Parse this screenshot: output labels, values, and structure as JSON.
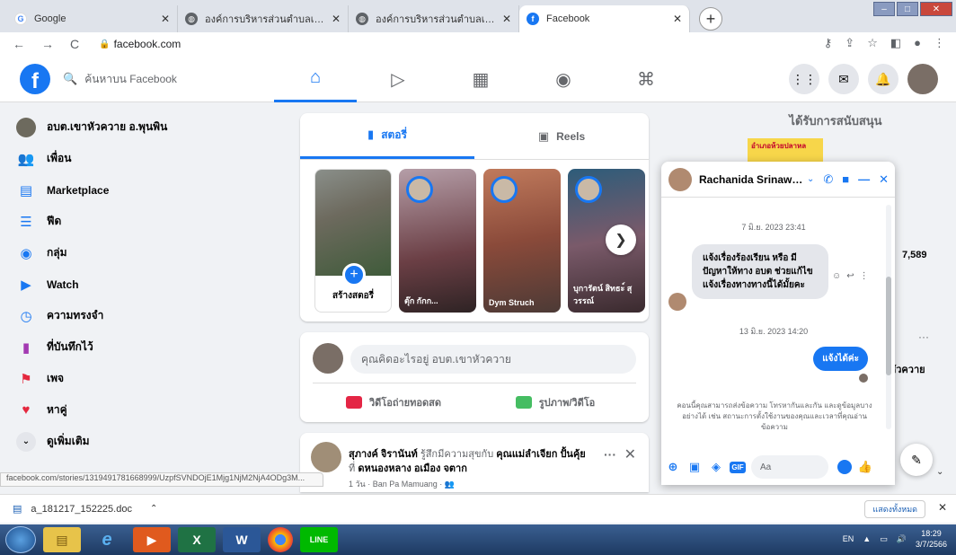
{
  "browser": {
    "tabs": [
      {
        "title": "Google",
        "icon": "google-icon"
      },
      {
        "title": "องค์การบริหารส่วนตำบลเขาหัวควาย",
        "icon": "globe-icon"
      },
      {
        "title": "องค์การบริหารส่วนตำบลเขาหัวควาย",
        "icon": "globe-icon"
      },
      {
        "title": "Facebook",
        "icon": "facebook-icon"
      }
    ],
    "url": "facebook.com"
  },
  "facebook": {
    "logo": "f",
    "search_placeholder": "ค้นหาบน Facebook"
  },
  "sidebar": {
    "items": [
      {
        "label": "อบต.เขาหัวควาย อ.พุนพิน",
        "icon": "page-avatar-icon"
      },
      {
        "label": "เพื่อน",
        "icon": "friends-icon"
      },
      {
        "label": "Marketplace",
        "icon": "marketplace-icon"
      },
      {
        "label": "ฟีด",
        "icon": "feeds-icon"
      },
      {
        "label": "กลุ่ม",
        "icon": "groups-icon"
      },
      {
        "label": "Watch",
        "icon": "watch-icon"
      },
      {
        "label": "ความทรงจำ",
        "icon": "memories-icon"
      },
      {
        "label": "ที่บันทึกไว้",
        "icon": "saved-icon"
      },
      {
        "label": "เพจ",
        "icon": "pages-icon"
      },
      {
        "label": "หาคู่",
        "icon": "dating-icon"
      },
      {
        "label": "ดูเพิ่มเติม",
        "icon": "chevron-down-icon"
      }
    ]
  },
  "stories": {
    "tab_stories": "สตอรี่",
    "tab_reels": "Reels",
    "create_label": "สร้างสตอรี่",
    "cards": [
      {
        "name": "ตุ๊ก กักก..."
      },
      {
        "name": "Dym Struch"
      },
      {
        "name": "บุการัตน์ สิทธะ์ สุวรรณ์"
      }
    ]
  },
  "composer": {
    "placeholder": "คุณคิดอะไรอยู่ อบต.เขาหัวควาย",
    "live_label": "วิดีโอถ่ายทอดสด",
    "photo_label": "รูปภาพ/วิดีโอ"
  },
  "post": {
    "author": "สุภางค์ จิรานันท์",
    "feeling": "รู้สึกมีความสุขกับ",
    "with": "คุณแม่ลำเจียก ปั้นคุ้ย",
    "at": "ที่",
    "place": "ดหนองหลาง อเมือง จตาก",
    "meta": "1 วัน · Ban Pa Mamuang · 👥"
  },
  "right": {
    "sponsored_title": "ได้รับการสนับสนุน",
    "ad_text": "อำเภอห้วยปลาหล",
    "count": "7,589",
    "text": "หัวควาย"
  },
  "chat": {
    "name": "Rachanida Srinawa...",
    "date1": "7 มิ.ย. 2023 23:41",
    "message_in": "แจ้งเรื่องร้องเรียน หรือ มีปัญหาให้ทาง อบต ช่วยแก้ไข แจ้งเรื่องทางทางนี้ได้มั้ยคะ",
    "date2": "13 มิ.ย. 2023 14:20",
    "message_out": "แจ้งได้ค่ะ",
    "notice": "คอนนี้คุณสามารถส่งข้อความ โทรหากันและกัน และดูข้อมูลบางอย่างได้ เช่น สถานะการตั้งใช้งานของคุณและเวลาที่คุณอ่านข้อความ",
    "input_placeholder": "Aa"
  },
  "status_link": "facebook.com/stories/1319491781668999/UzpfSVNDOjE1Mjg1NjM2NjA4ODg3M...",
  "download": {
    "file": "a_181217_152225.doc",
    "show_all": "แสดงทั้งหมด"
  },
  "taskbar": {
    "lang": "EN",
    "time": "18:29",
    "date": "3/7/2566"
  },
  "colors": {
    "brand": "#1877f2",
    "background": "#f0f2f5"
  }
}
